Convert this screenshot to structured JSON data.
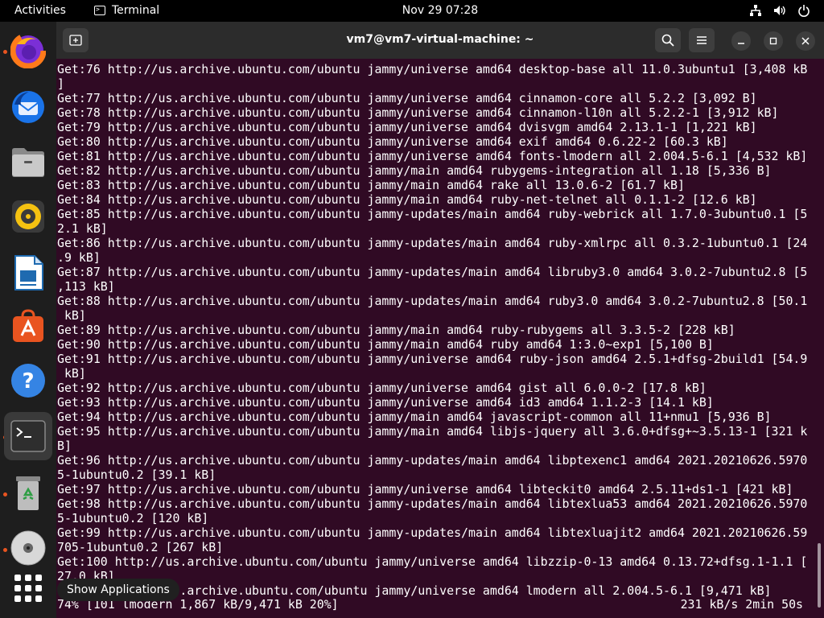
{
  "topbar": {
    "activities": "Activities",
    "app_name": "Terminal",
    "clock": "Nov 29  07:28"
  },
  "dock": {
    "items": [
      "firefox-icon",
      "thunderbird-icon",
      "files-icon",
      "rhythmbox-icon",
      "libreoffice-writer-icon",
      "app-center-icon",
      "help-icon",
      "terminal-icon",
      "trash-icon",
      "dvd-icon"
    ],
    "show_apps_tooltip": "Show Applications"
  },
  "window": {
    "title": "vm7@vm7-virtual-machine: ~"
  },
  "terminal": {
    "lines": [
      "Get:76 http://us.archive.ubuntu.com/ubuntu jammy/universe amd64 desktop-base all 11.0.3ubuntu1 [3,408 kB",
      "]",
      "Get:77 http://us.archive.ubuntu.com/ubuntu jammy/universe amd64 cinnamon-core all 5.2.2 [3,092 B]",
      "Get:78 http://us.archive.ubuntu.com/ubuntu jammy/universe amd64 cinnamon-l10n all 5.2.2-1 [3,912 kB]",
      "Get:79 http://us.archive.ubuntu.com/ubuntu jammy/universe amd64 dvisvgm amd64 2.13.1-1 [1,221 kB]",
      "Get:80 http://us.archive.ubuntu.com/ubuntu jammy/universe amd64 exif amd64 0.6.22-2 [60.3 kB]",
      "Get:81 http://us.archive.ubuntu.com/ubuntu jammy/universe amd64 fonts-lmodern all 2.004.5-6.1 [4,532 kB]",
      "Get:82 http://us.archive.ubuntu.com/ubuntu jammy/main amd64 rubygems-integration all 1.18 [5,336 B]",
      "Get:83 http://us.archive.ubuntu.com/ubuntu jammy/main amd64 rake all 13.0.6-2 [61.7 kB]",
      "Get:84 http://us.archive.ubuntu.com/ubuntu jammy/main amd64 ruby-net-telnet all 0.1.1-2 [12.6 kB]",
      "Get:85 http://us.archive.ubuntu.com/ubuntu jammy-updates/main amd64 ruby-webrick all 1.7.0-3ubuntu0.1 [5",
      "2.1 kB]",
      "Get:86 http://us.archive.ubuntu.com/ubuntu jammy-updates/main amd64 ruby-xmlrpc all 0.3.2-1ubuntu0.1 [24",
      ".9 kB]",
      "Get:87 http://us.archive.ubuntu.com/ubuntu jammy-updates/main amd64 libruby3.0 amd64 3.0.2-7ubuntu2.8 [5",
      ",113 kB]",
      "Get:88 http://us.archive.ubuntu.com/ubuntu jammy-updates/main amd64 ruby3.0 amd64 3.0.2-7ubuntu2.8 [50.1",
      " kB]",
      "Get:89 http://us.archive.ubuntu.com/ubuntu jammy/main amd64 ruby-rubygems all 3.3.5-2 [228 kB]",
      "Get:90 http://us.archive.ubuntu.com/ubuntu jammy/main amd64 ruby amd64 1:3.0~exp1 [5,100 B]",
      "Get:91 http://us.archive.ubuntu.com/ubuntu jammy/universe amd64 ruby-json amd64 2.5.1+dfsg-2build1 [54.9",
      " kB]",
      "Get:92 http://us.archive.ubuntu.com/ubuntu jammy/universe amd64 gist all 6.0.0-2 [17.8 kB]",
      "Get:93 http://us.archive.ubuntu.com/ubuntu jammy/universe amd64 id3 amd64 1.1.2-3 [14.1 kB]",
      "Get:94 http://us.archive.ubuntu.com/ubuntu jammy/main amd64 javascript-common all 11+nmu1 [5,936 B]",
      "Get:95 http://us.archive.ubuntu.com/ubuntu jammy/main amd64 libjs-jquery all 3.6.0+dfsg+~3.5.13-1 [321 k",
      "B]",
      "Get:96 http://us.archive.ubuntu.com/ubuntu jammy-updates/main amd64 libptexenc1 amd64 2021.20210626.5970",
      "5-1ubuntu0.2 [39.1 kB]",
      "Get:97 http://us.archive.ubuntu.com/ubuntu jammy/universe amd64 libteckit0 amd64 2.5.11+ds1-1 [421 kB]",
      "Get:98 http://us.archive.ubuntu.com/ubuntu jammy-updates/main amd64 libtexlua53 amd64 2021.20210626.5970",
      "5-1ubuntu0.2 [120 kB]",
      "Get:99 http://us.archive.ubuntu.com/ubuntu jammy-updates/main amd64 libtexluajit2 amd64 2021.20210626.59",
      "705-1ubuntu0.2 [267 kB]",
      "Get:100 http://us.archive.ubuntu.com/ubuntu jammy/universe amd64 libzzip-0-13 amd64 0.13.72+dfsg.1-1.1 [",
      "27.0 kB]",
      "Get:101 http://us.archive.ubuntu.com/ubuntu jammy/universe amd64 lmodern all 2.004.5-6.1 [9,471 kB]"
    ],
    "status_left": "74% [101 lmodern 1,867 kB/9,471 kB 20%]",
    "status_right": "231 kB/s 2min 50s"
  }
}
